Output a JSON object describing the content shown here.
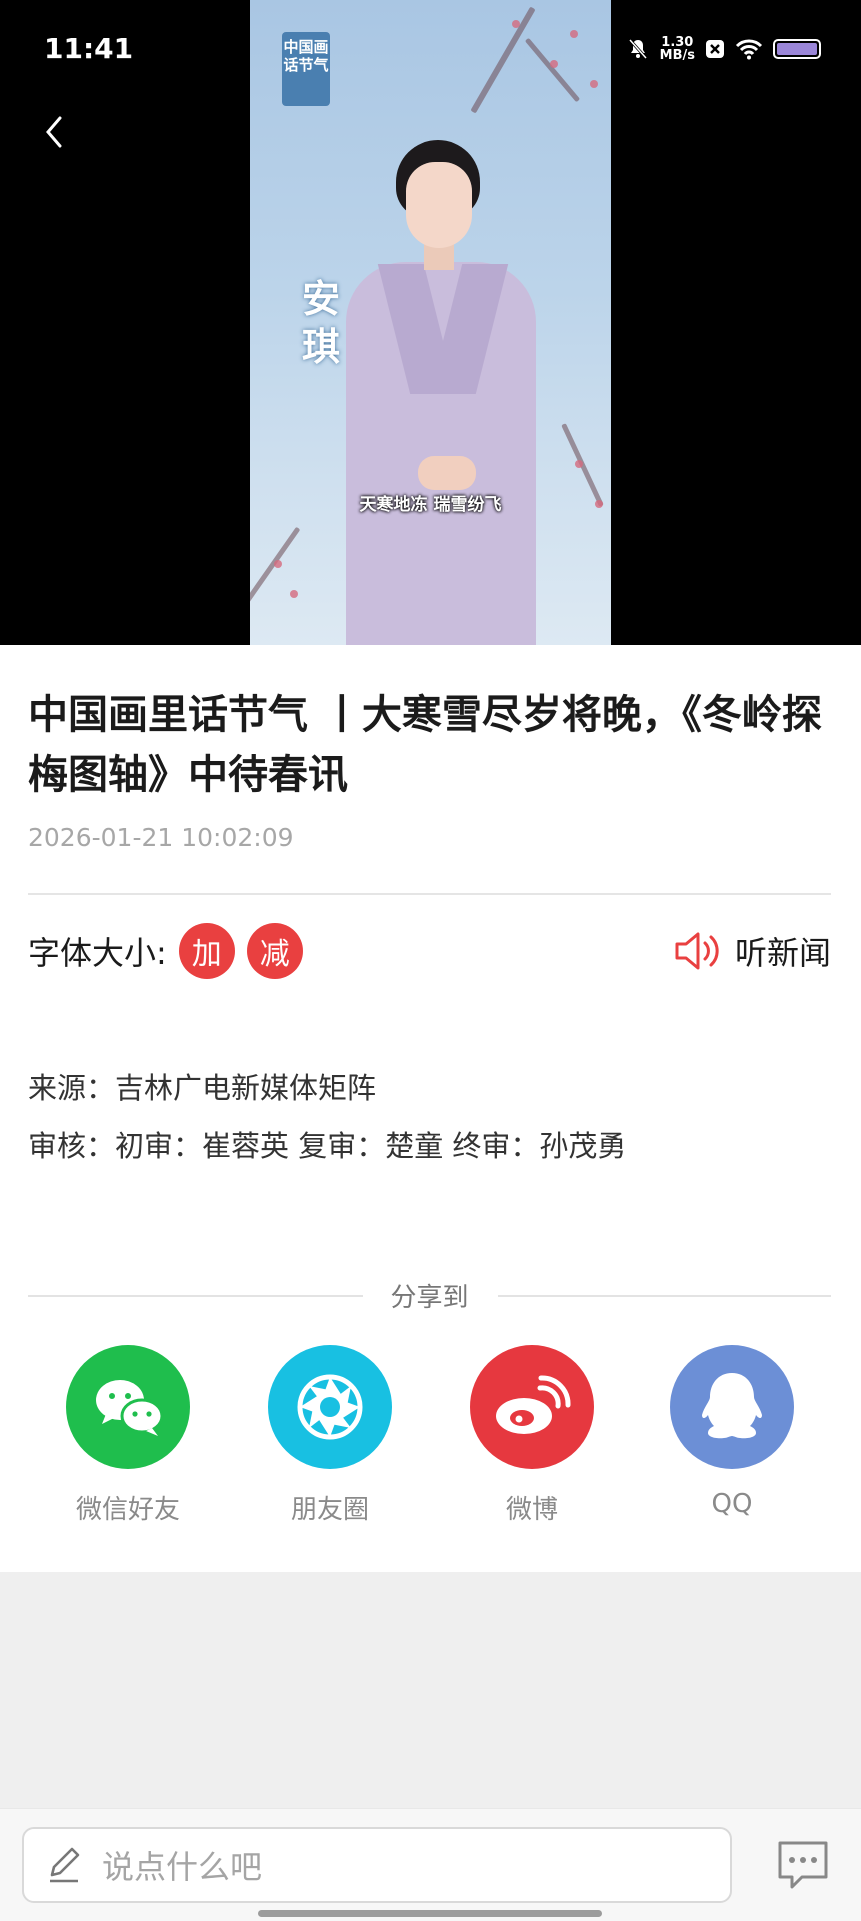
{
  "status_bar": {
    "time": "11:41",
    "net_speed_value": "1.30",
    "net_speed_unit": "MB/s"
  },
  "video": {
    "logo_text": "中国画话节气",
    "presenter_name": "安琪",
    "subtitle": "天寒地冻 瑞雪纷飞"
  },
  "article": {
    "title": "中国画里话节气 丨大寒雪尽岁将晚，《冬岭探梅图轴》中待春讯",
    "date": "2026-01-21 10:02:09",
    "font_size_label": "字体大小:",
    "increase_label": "加",
    "decrease_label": "减",
    "listen_label": "听新闻",
    "source": "来源：吉林广电新媒体矩阵",
    "review": "审核：初审：崔蓉英 复审：楚童 终审：孙茂勇"
  },
  "share": {
    "heading": "分享到",
    "targets": [
      {
        "label": "微信好友",
        "color": "#1fbe4d",
        "icon": "wechat-icon"
      },
      {
        "label": "朋友圈",
        "color": "#18c0e2",
        "icon": "moments-icon"
      },
      {
        "label": "微博",
        "color": "#e6383f",
        "icon": "weibo-icon"
      },
      {
        "label": "QQ",
        "color": "#6c8fd6",
        "icon": "qq-icon"
      }
    ]
  },
  "bottom_bar": {
    "comment_placeholder": "说点什么吧"
  }
}
